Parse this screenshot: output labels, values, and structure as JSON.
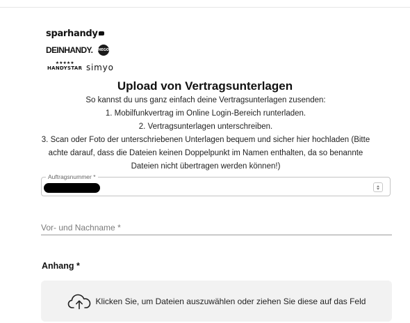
{
  "brands": {
    "sparhandy": "sparhandy",
    "deinhandy": "DEINHANDY.",
    "badge": "HEGO",
    "handystar_stars": "★★★★★",
    "handystar": "HANDYSTAR",
    "simyo": "simyo"
  },
  "upload": {
    "title": "Upload von Vertragsunterlagen",
    "intro": "So kannst du uns ganz einfach deine Vertragsunterlagen zusenden:",
    "steps": [
      "1. Mobilfunkvertrag im Online Login-Bereich runterladen.",
      "2. Vertragsunterlagen unterschreiben.",
      "3. Scan oder Foto der unterschriebenen Unterlagen bequem und sicher hier hochladen (Bitte achte darauf, dass die Dateien keinen Doppelpunkt im Namen enthalten, da so benannte Dateien nicht übertragen werden können!)"
    ]
  },
  "form": {
    "order_number_label": "Auftragsnummer *",
    "name_placeholder": "Vor- und Nachname *",
    "attachment_label": "Anhang *",
    "dropzone_text": "Klicken Sie, um Dateien auszuwählen oder ziehen Sie diese auf das Feld"
  }
}
